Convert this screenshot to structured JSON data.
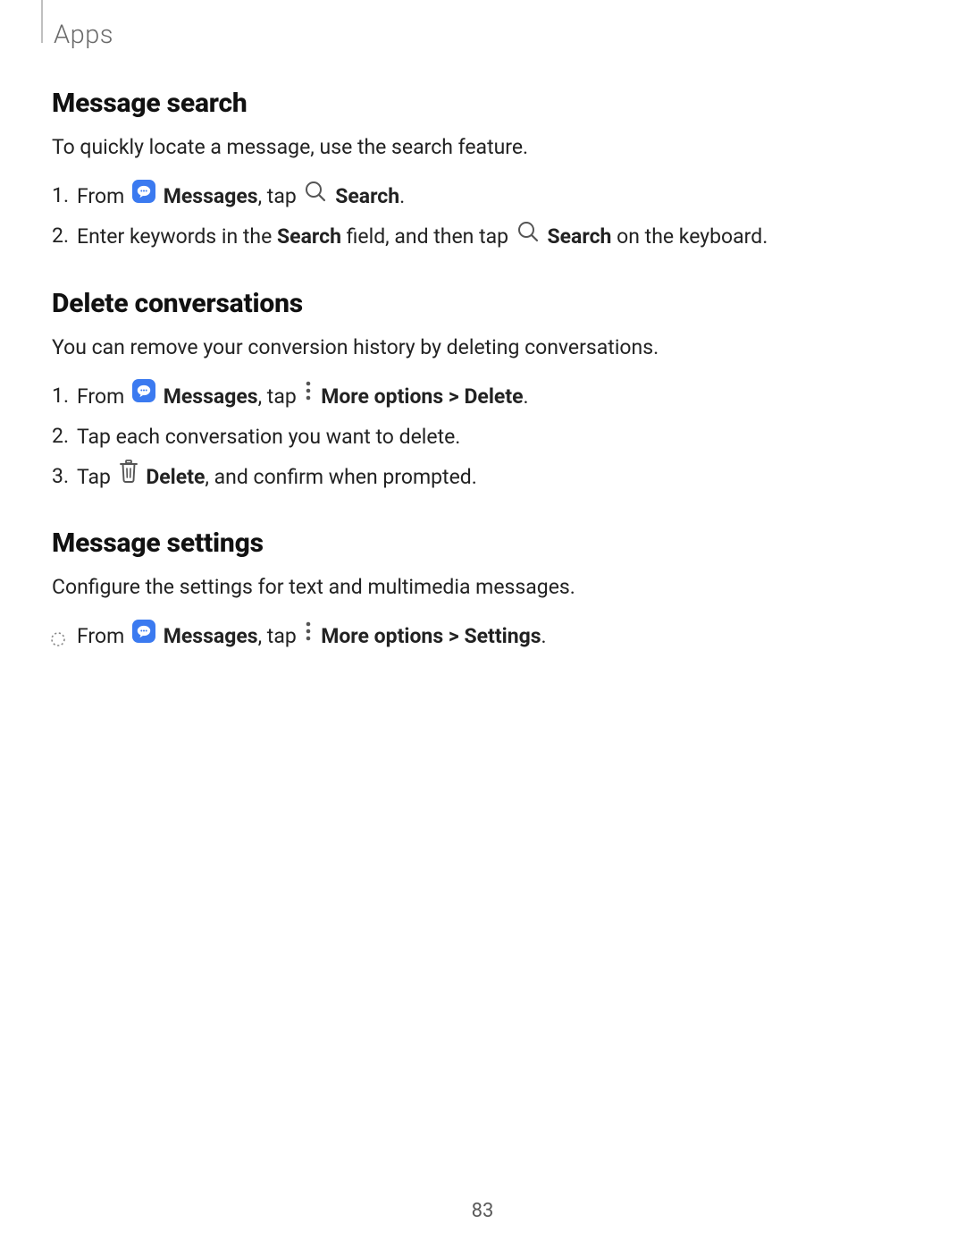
{
  "header": "Apps",
  "page_number": "83",
  "sections": {
    "message_search": {
      "heading": "Message search",
      "intro": "To quickly locate a message, use the search feature.",
      "step1": {
        "t1": "From ",
        "messages": "Messages",
        "t2": ", tap ",
        "search": "Search",
        "t3": "."
      },
      "step2": {
        "t1": "Enter keywords in the ",
        "search_field": "Search",
        "t2": " field, and then tap ",
        "search_kb": "Search",
        "t3": " on the keyboard."
      }
    },
    "delete_conversations": {
      "heading": "Delete conversations",
      "intro": "You can remove your conversion history by deleting conversations.",
      "step1": {
        "t1": "From ",
        "messages": "Messages",
        "t2": ", tap ",
        "more_options": "More options",
        "chevron": " > ",
        "delete": "Delete",
        "t3": "."
      },
      "step2": "Tap each conversation you want to delete.",
      "step3": {
        "t1": "Tap ",
        "delete": "Delete",
        "t2": ", and confirm when prompted."
      }
    },
    "message_settings": {
      "heading": "Message settings",
      "intro": "Configure the settings for text and multimedia messages.",
      "step1": {
        "t1": "From ",
        "messages": "Messages",
        "t2": ", tap ",
        "more_options": "More options",
        "chevron": " > ",
        "settings": "Settings",
        "t3": "."
      }
    }
  },
  "icons": {
    "messages": "messages-app-icon",
    "search": "magnifier-icon",
    "more_options": "three-dots-vertical-icon",
    "delete": "trash-icon",
    "bullet": "dashed-circle-icon"
  },
  "colors": {
    "accent": "#3b7af0",
    "text": "#222222",
    "header_text": "#6a6a6a",
    "header_rule": "#c0c0c0"
  }
}
